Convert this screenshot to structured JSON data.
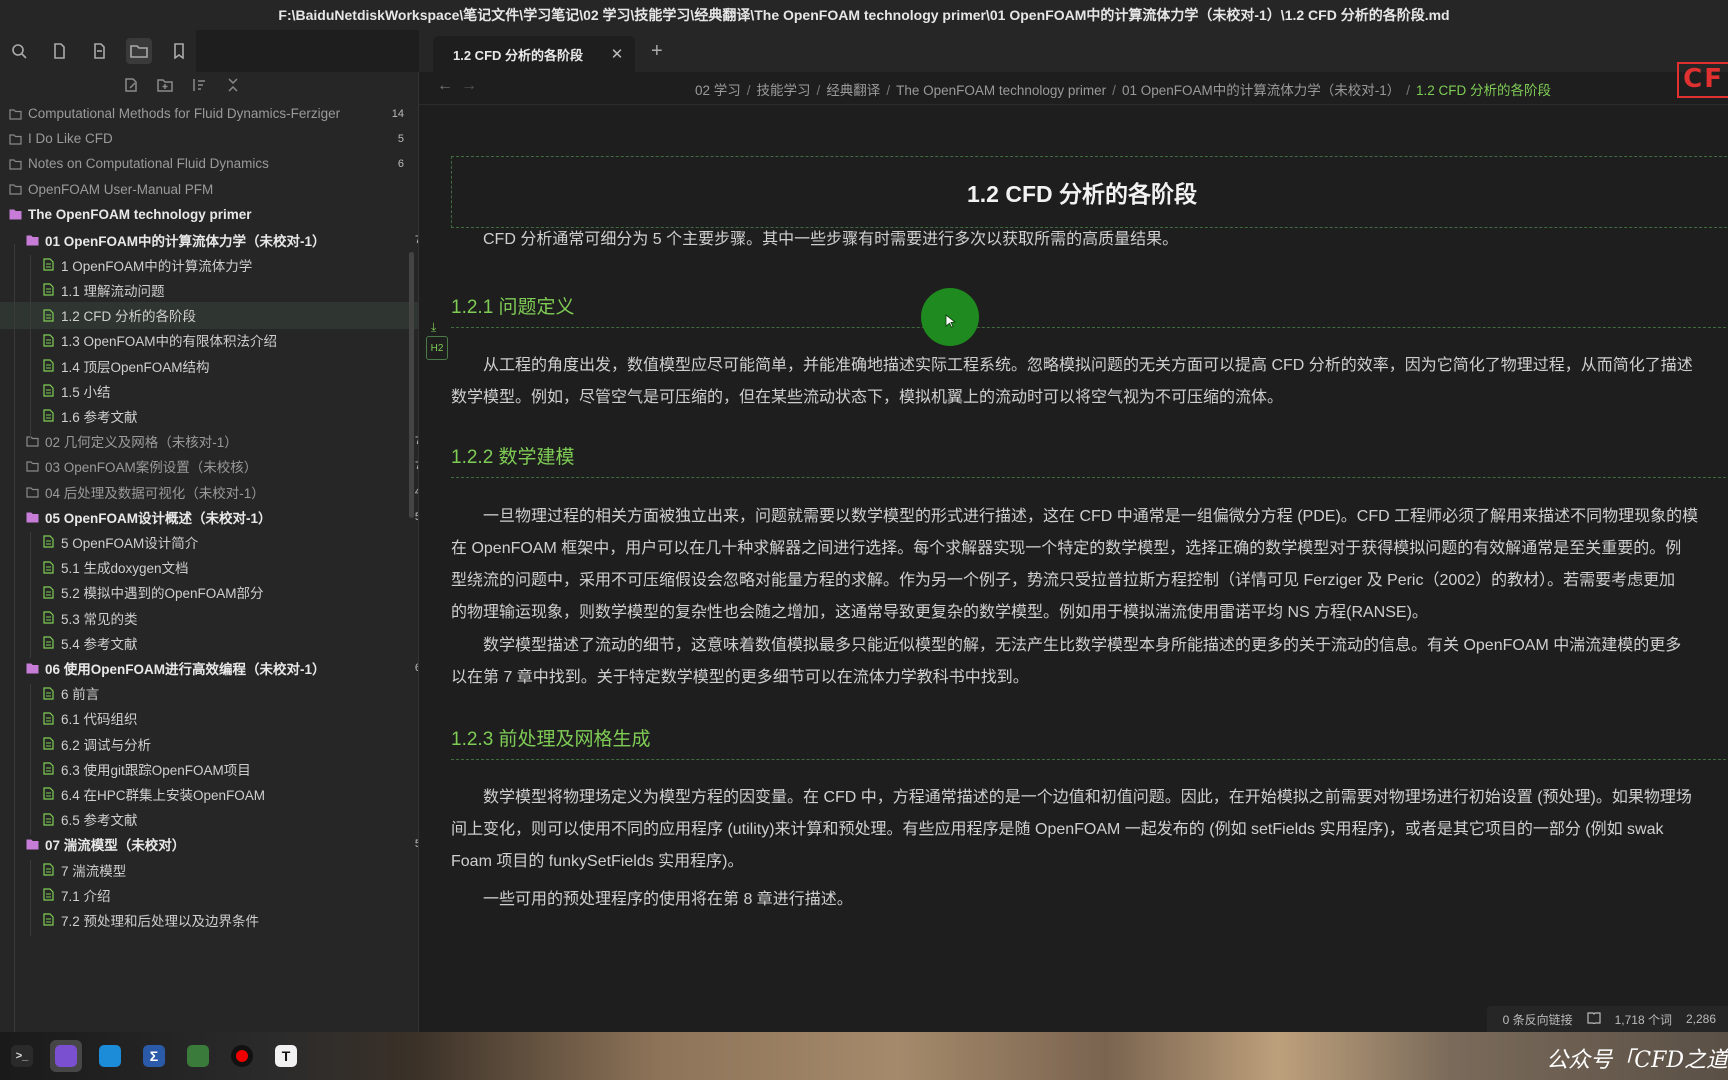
{
  "window": {
    "title": "F:\\BaiduNetdiskWorkspace\\笔记文件\\学习笔记\\02 学习\\技能学习\\经典翻译\\The OpenFOAM technology primer\\01 OpenFOAM中的计算流体力学（未校对-1）\\1.2 CFD 分析的各阶段.md"
  },
  "ribbon": {
    "icons": [
      "search-icon",
      "file-icon",
      "file-icon",
      "folder-icon",
      "bookmark-icon"
    ]
  },
  "sidebar": {
    "actions": [
      "new-note-icon",
      "new-folder-icon",
      "sort-icon",
      "collapse-icon"
    ],
    "items": [
      {
        "label": "Computational Methods for Fluid Dynamics-Ferziger",
        "count": "14",
        "type": "folder",
        "level": 0
      },
      {
        "label": "I Do Like CFD",
        "count": "5",
        "type": "folder",
        "level": 0
      },
      {
        "label": "Notes on Computational Fluid Dynamics",
        "count": "6",
        "type": "folder",
        "level": 0
      },
      {
        "label": "OpenFOAM User-Manual PFM",
        "count": "",
        "type": "folder",
        "level": 0
      },
      {
        "label": "The OpenFOAM technology primer",
        "count": "",
        "type": "folder-open",
        "level": 0
      },
      {
        "label": "01 OpenFOAM中的计算流体力学（未校对-1）",
        "count": "7",
        "type": "folder-open",
        "level": 1
      },
      {
        "label": "1 OpenFOAM中的计算流体力学",
        "count": "",
        "type": "file",
        "level": 2
      },
      {
        "label": "1.1 理解流动问题",
        "count": "",
        "type": "file",
        "level": 2
      },
      {
        "label": "1.2 CFD 分析的各阶段",
        "count": "",
        "type": "file",
        "level": 2,
        "active": true
      },
      {
        "label": "1.3 OpenFOAM中的有限体积法介绍",
        "count": "",
        "type": "file",
        "level": 2
      },
      {
        "label": "1.4 顶层OpenFOAM结构",
        "count": "",
        "type": "file",
        "level": 2
      },
      {
        "label": "1.5 小结",
        "count": "",
        "type": "file",
        "level": 2
      },
      {
        "label": "1.6 参考文献",
        "count": "",
        "type": "file",
        "level": 2
      },
      {
        "label": "02 几何定义及网格（未核对-1）",
        "count": "7",
        "type": "folder",
        "level": 1
      },
      {
        "label": "03 OpenFOAM案例设置（未校核）",
        "count": "7",
        "type": "folder",
        "level": 1
      },
      {
        "label": "04 后处理及数据可视化（未校对-1）",
        "count": "4",
        "type": "folder",
        "level": 1
      },
      {
        "label": "05 OpenFOAM设计概述（未校对-1）",
        "count": "5",
        "type": "folder-open",
        "level": 1
      },
      {
        "label": "5 OpenFOAM设计简介",
        "count": "",
        "type": "file",
        "level": 2
      },
      {
        "label": "5.1 生成doxygen文档",
        "count": "",
        "type": "file",
        "level": 2
      },
      {
        "label": "5.2 模拟中遇到的OpenFOAM部分",
        "count": "",
        "type": "file",
        "level": 2
      },
      {
        "label": "5.3 常见的类",
        "count": "",
        "type": "file",
        "level": 2
      },
      {
        "label": "5.4 参考文献",
        "count": "",
        "type": "file",
        "level": 2
      },
      {
        "label": "06 使用OpenFOAM进行高效编程（未校对-1）",
        "count": "6",
        "type": "folder-open",
        "level": 1
      },
      {
        "label": "6 前言",
        "count": "",
        "type": "file",
        "level": 2
      },
      {
        "label": "6.1 代码组织",
        "count": "",
        "type": "file",
        "level": 2
      },
      {
        "label": "6.2 调试与分析",
        "count": "",
        "type": "file",
        "level": 2
      },
      {
        "label": "6.3 使用git跟踪OpenFOAM项目",
        "count": "",
        "type": "file",
        "level": 2
      },
      {
        "label": "6.4 在HPC群集上安装OpenFOAM",
        "count": "",
        "type": "file",
        "level": 2
      },
      {
        "label": "6.5 参考文献",
        "count": "",
        "type": "file",
        "level": 2
      },
      {
        "label": "07 湍流模型（未校对）",
        "count": "5",
        "type": "folder-open",
        "level": 1
      },
      {
        "label": "7 湍流模型",
        "count": "",
        "type": "file",
        "level": 2
      },
      {
        "label": "7.1 介绍",
        "count": "",
        "type": "file",
        "level": 2
      },
      {
        "label": "7.2 预处理和后处理以及边界条件",
        "count": "",
        "type": "file",
        "level": 2
      }
    ]
  },
  "tabs": [
    {
      "label": "1.2 CFD 分析的各阶段",
      "close": "✕"
    }
  ],
  "newtab": "+",
  "nav": {
    "back": "←",
    "forward": "→",
    "breadcrumbs": [
      "02 学习",
      "技能学习",
      "经典翻译",
      "The OpenFOAM technology primer",
      "01 OpenFOAM中的计算流体力学（未校对-1）"
    ],
    "current": "1.2 CFD 分析的各阶段",
    "separator": "/"
  },
  "logo_fragment": "CF",
  "doc": {
    "title": "1.2 CFD 分析的各阶段",
    "intro": "CFD 分析通常可细分为 5 个主要步骤。其中一些步骤有时需要进行多次以获取所需的高质量结果。",
    "h2_marker": "H2",
    "sections": [
      {
        "heading": "1.2.1 问题定义",
        "lines": [
          "从工程的角度出发，数值模型应尽可能简单，并能准确地描述实际工程系统。忽略模拟问题的无关方面可以提高 CFD 分析的效率，因为它简化了物理过程，从而简化了描述",
          "数学模型。例如，尽管空气是可压缩的，但在某些流动状态下，模拟机翼上的流动时可以将空气视为不可压缩的流体。"
        ]
      },
      {
        "heading": "1.2.2 数学建模",
        "lines": [
          "一旦物理过程的相关方面被独立出来，问题就需要以数学模型的形式进行描述，这在 CFD 中通常是一组偏微分方程 (PDE)。CFD 工程师必须了解用来描述不同物理现象的模",
          "在 OpenFOAM 框架中，用户可以在几十种求解器之间进行选择。每个求解器实现一个特定的数学模型，选择正确的数学模型对于获得模拟问题的有效解通常是至关重要的。例",
          "型绕流的问题中，采用不可压缩假设会忽略对能量方程的求解。作为另一个例子，势流只受拉普拉斯方程控制（详情可见 Ferziger 及 Peric（2002）的教材）。若需要考虑更加",
          "的物理输运现象，则数学模型的复杂性也会随之增加，这通常导致更复杂的数学模型。例如用于模拟湍流使用雷诺平均 NS 方程(RANSE)。"
        ],
        "lines2": [
          "数学模型描述了流动的细节，这意味着数值模拟最多只能近似模型的解，无法产生比数学模型本身所能描述的更多的关于流动的信息。有关 OpenFOAM 中湍流建模的更多",
          "以在第 7 章中找到。关于特定数学模型的更多细节可以在流体力学教科书中找到。"
        ]
      },
      {
        "heading": "1.2.3 前处理及网格生成",
        "lines": [
          "数学模型将物理场定义为模型方程的因变量。在 CFD 中，方程通常描述的是一个边值和初值问题。因此，在开始模拟之前需要对物理场进行初始设置 (预处理)。如果物理场",
          "间上变化，则可以使用不同的应用程序 (utility)来计算和预处理。有些应用程序是随 OpenFOAM 一起发布的 (例如 setFields 实用程序)，或者是其它项目的一部分 (例如 swak",
          "Foam 项目的 funkySetFields 实用程序)。"
        ],
        "lines2": [
          "一些可用的预处理程序的使用将在第 8 章进行描述。"
        ]
      }
    ]
  },
  "status": {
    "backlinks": "0 条反向链接",
    "words": "1,718 个词",
    "chars": "2,286"
  },
  "taskbar": {
    "icons": [
      "terminal-icon",
      "obsidian-icon",
      "edge-icon",
      "powershell-icon",
      "app-icon",
      "record-icon",
      "typora-icon"
    ],
    "labels": [
      "",
      "",
      "",
      "Σ",
      "",
      "",
      "T"
    ],
    "signature": "公众号「CFD之道"
  },
  "colors": {
    "accent": "#7fcc55",
    "bg": "#1e1e1e",
    "sidebar_bg": "#262626",
    "folder_icon": "#c77dd8",
    "file_icon": "#7fcc55",
    "cursor": "#1f8a1f",
    "logo": "#e03030"
  }
}
